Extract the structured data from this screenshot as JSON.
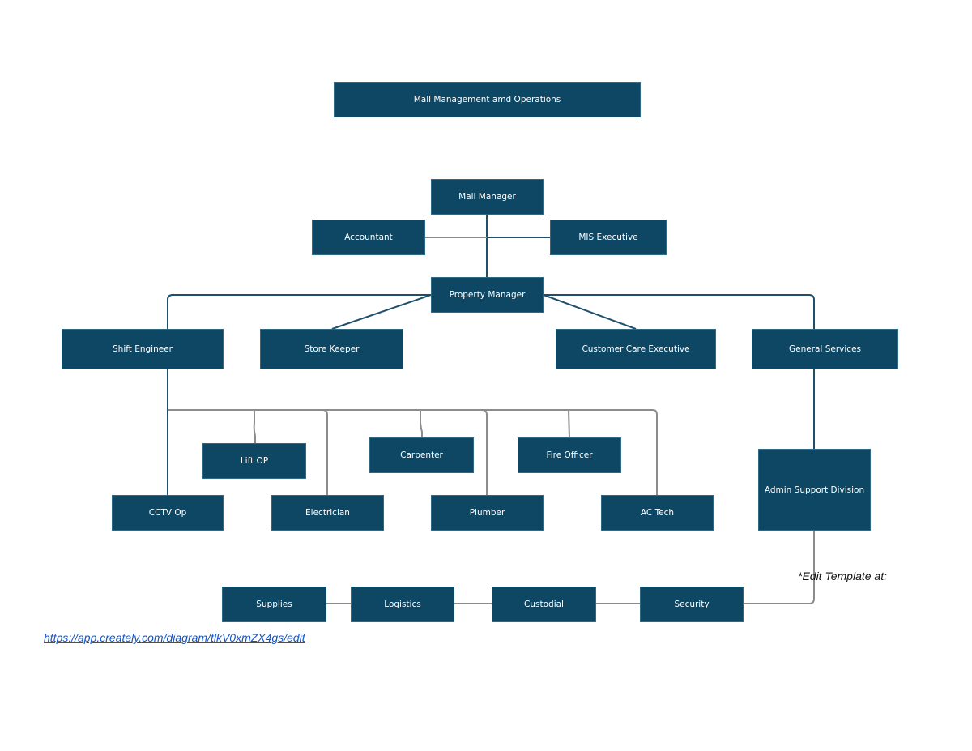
{
  "title": "Mall Management amd Operations",
  "nodes": {
    "mall_manager": "Mall Manager",
    "accountant": "Accountant",
    "mis_executive": "MIS Executive",
    "property_manager": "Property Manager",
    "shift_engineer": "Shift Engineer",
    "store_keeper": "Store Keeper",
    "customer_care_executive": "Customer Care Executive",
    "general_services": "General Services",
    "lift_op": "Lift OP",
    "carpenter": "Carpenter",
    "fire_officer": "Fire Officer",
    "cctv_op": "CCTV Op",
    "electrician": "Electrician",
    "plumber": "Plumber",
    "ac_tech": "AC Tech",
    "admin_support_division": "Admin Support Division",
    "supplies": "Supplies",
    "logistics": "Logistics",
    "custodial": "Custodial",
    "security": "Security"
  },
  "edges": [
    [
      "mall_manager",
      "property_manager"
    ],
    [
      "mall_manager",
      "accountant"
    ],
    [
      "mall_manager",
      "mis_executive"
    ],
    [
      "property_manager",
      "shift_engineer"
    ],
    [
      "property_manager",
      "store_keeper"
    ],
    [
      "property_manager",
      "customer_care_executive"
    ],
    [
      "property_manager",
      "general_services"
    ],
    [
      "shift_engineer",
      "cctv_op"
    ],
    [
      "shift_engineer",
      "lift_op"
    ],
    [
      "shift_engineer",
      "electrician"
    ],
    [
      "shift_engineer",
      "carpenter"
    ],
    [
      "shift_engineer",
      "plumber"
    ],
    [
      "shift_engineer",
      "fire_officer"
    ],
    [
      "shift_engineer",
      "ac_tech"
    ],
    [
      "general_services",
      "admin_support_division"
    ],
    [
      "admin_support_division",
      "security"
    ],
    [
      "security",
      "custodial"
    ],
    [
      "custodial",
      "logistics"
    ],
    [
      "logistics",
      "supplies"
    ]
  ],
  "colors": {
    "node_fill": "#0d4764",
    "primary_connector": "#1f4f6b",
    "secondary_connector": "#8c8c8c",
    "link": "#1155cc"
  },
  "note": "*Edit Template at:",
  "link_text": "https://app.creately.com/diagram/tlkV0xmZX4gs/edit"
}
